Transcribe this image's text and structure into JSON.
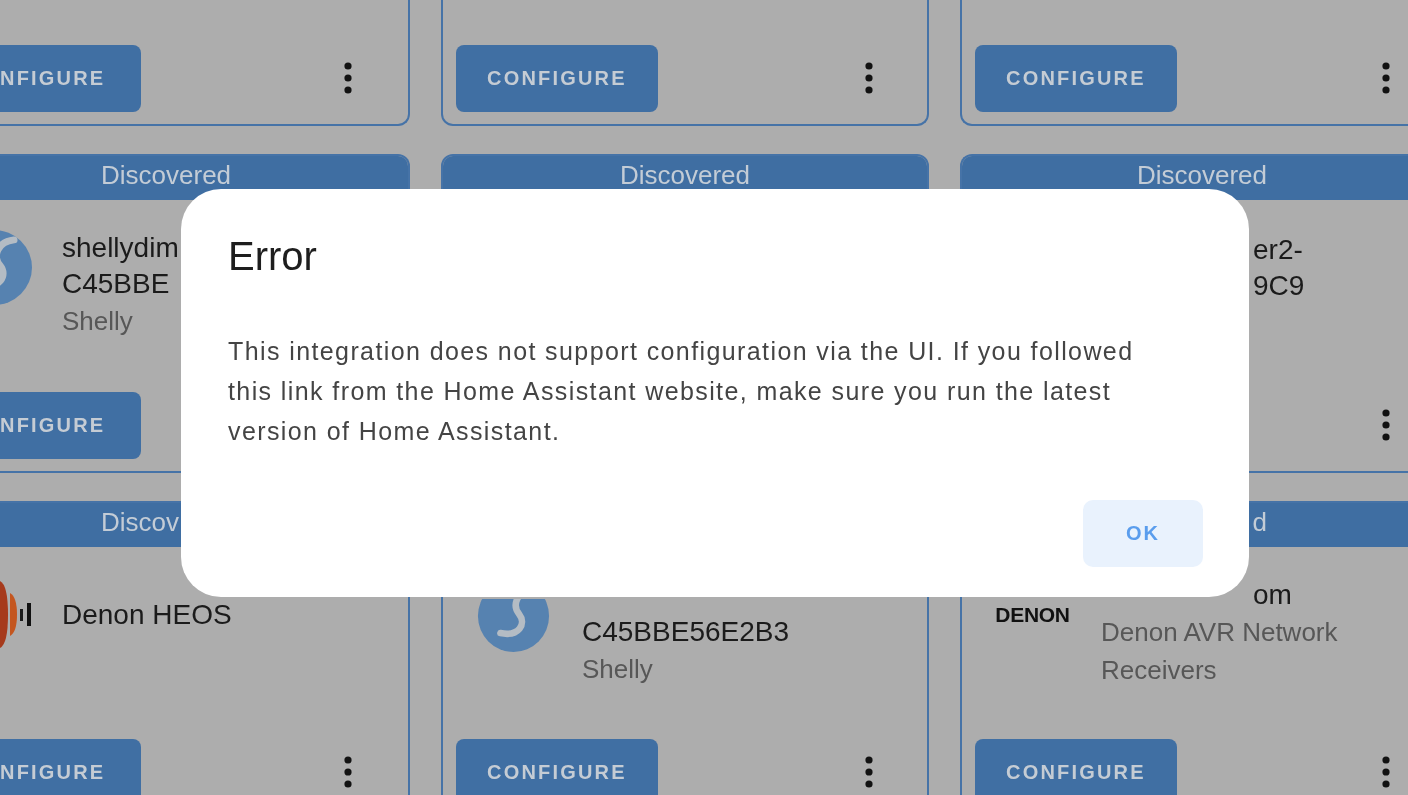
{
  "cards": [
    {
      "configure_label": "NFIGURE",
      "menu": true
    },
    {
      "configure_label": "CONFIGURE",
      "menu": true
    },
    {
      "configure_label": "CONFIGURE",
      "menu": true
    },
    {
      "header": "Discovered",
      "logo": {
        "kind": "swirl"
      },
      "name_lines": [
        "shellydim",
        "C45BBE"
      ],
      "subtitle": "Shelly",
      "configure_label": "NFIGURE"
    },
    {
      "header": "Discovered"
    },
    {
      "header": "Discovered",
      "name_lines": [
        "er2-",
        "9C9"
      ],
      "menu": true
    },
    {
      "header": "Discov",
      "logo": {
        "kind": "bars"
      },
      "name_lines": [
        "Denon HEOS"
      ],
      "configure_label": "NFIGURE",
      "menu": true
    },
    {
      "logo": {
        "kind": "swirl"
      },
      "name_lines": [
        "C45BBE56E2B3"
      ],
      "subtitle": "Shelly",
      "configure_label": "CONFIGURE",
      "menu": true
    },
    {
      "header": "d",
      "logo": {
        "kind": "wordmark",
        "text": "DENON"
      },
      "name_lines": [
        "om"
      ],
      "subtitle": "Denon AVR Network Receivers",
      "configure_label": "CONFIGURE",
      "menu": true
    }
  ],
  "dialog": {
    "title": "Error",
    "message": "This integration does not support configuration via the UI. If you followed this link from the Home Assistant website, make sure you run the latest version of Home Assistant.",
    "button": "OK"
  }
}
